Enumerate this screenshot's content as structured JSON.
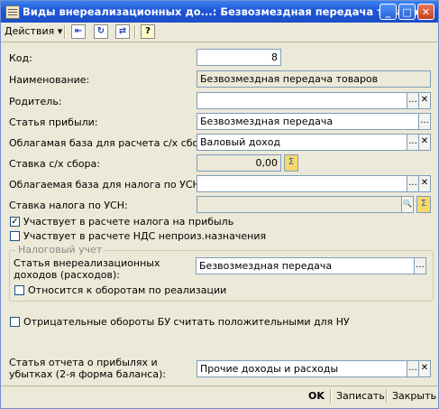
{
  "window": {
    "title": "Виды внереализационных до...: Безвозмездная передача товаров",
    "controls": {
      "minimize": "_",
      "maximize": "□",
      "close": "✕"
    }
  },
  "toolbar": {
    "actions_label": "Действия ▾"
  },
  "form": {
    "code": {
      "label": "Код:",
      "value": "8"
    },
    "name": {
      "label": "Наименование:",
      "value": "Безвозмездная передача товаров"
    },
    "parent": {
      "label": "Родитель:",
      "value": ""
    },
    "profit_item": {
      "label": "Статья прибыли:",
      "value": "Безвозмездная передача"
    },
    "agri_base": {
      "label": "Облагамая база для расчета с/х сбора:",
      "value": "Валовый доход"
    },
    "agri_rate": {
      "label": "Ставка с/х сбора:",
      "value": "0,00"
    },
    "usn_base": {
      "label": "Облагаемая база для налога по УСН:",
      "value": ""
    },
    "usn_rate": {
      "label": "Ставка налога по УСН:",
      "value": ""
    },
    "cb_profit_tax": {
      "label": "Участвует в расчете налога на прибыль",
      "checked": true
    },
    "cb_vat": {
      "label": "Участвует в расчете НДС непроиз.назначения",
      "checked": false
    },
    "tax_group": {
      "title": "Налоговый учет",
      "nonop_label": "Статья внереализационных доходов (расходов):",
      "nonop_value": "Безвозмездная передача",
      "cb_sales": {
        "label": "Относится к оборотам по реализации",
        "checked": false
      }
    },
    "cb_negative": {
      "label": "Отрицательные обороты БУ считать положительными для НУ",
      "checked": false
    },
    "report_item": {
      "label": "Статья отчета о прибылях и убытках (2-я форма баланса):",
      "value": "Прочие доходы и расходы"
    }
  },
  "footer": {
    "ok": "OK",
    "save": "Записать",
    "close": "Закрыть"
  },
  "glyphs": {
    "ellipsis": "...",
    "clear": "✕",
    "search": "🔍",
    "calc": "Σ",
    "check": "✓"
  }
}
